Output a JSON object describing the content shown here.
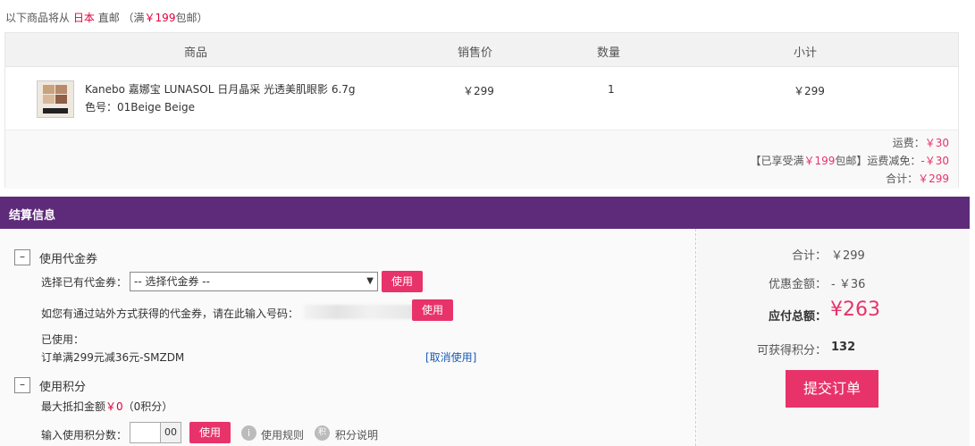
{
  "ship_note": {
    "prefix": "以下商品将从",
    "country": "日本",
    "suffix": "直邮",
    "free_prefix": "（满",
    "free_amount": "￥199",
    "free_suffix": "包邮）"
  },
  "table": {
    "headers": {
      "product": "商品",
      "price": "销售价",
      "qty": "数量",
      "subtotal": "小计"
    },
    "item": {
      "name": "Kanebo 嘉娜宝 LUNASOL 日月晶采 光透美肌眼影 6.7g",
      "color": "色号：01Beige Beige",
      "price": "￥299",
      "qty": "1",
      "subtotal": "￥299"
    },
    "fees": {
      "shipping_label": "运费：",
      "shipping_value": "￥30",
      "discount_prefix": "【已享受满",
      "discount_amount": "￥199",
      "discount_mid": "包邮】运费减免：",
      "discount_value": "-￥30",
      "total_label": "合计：",
      "total_value": "￥299"
    }
  },
  "section_title": "结算信息",
  "coupon": {
    "toggle": "–",
    "title": "使用代金券",
    "select_label": "选择已有代金券：",
    "select_value": "-- 选择代金券 --",
    "use_button": "使用",
    "code_prompt": "如您有通过站外方式获得的代金券，请在此输入号码：",
    "code_button": "使用",
    "used_label": "已使用：",
    "used_coupon": "订单满299元减36元-SMZDM",
    "cancel_link": "[取消使用]"
  },
  "points": {
    "toggle": "–",
    "title": "使用积分",
    "max_label": "最大抵扣金额",
    "max_amount": "￥0",
    "max_points": "（0积分）",
    "input_label": "输入使用积分数：",
    "input_suffix": "00",
    "use_button": "使用",
    "rules_icon": "i",
    "rules_link": "使用规则",
    "info_icon": "积",
    "info_link": "积分说明"
  },
  "summary": {
    "total_label": "合计：",
    "total_value": "￥299",
    "discount_label": "优惠金额：",
    "discount_value": "- ￥36",
    "payable_label": "应付总额：",
    "payable_value": "¥263",
    "points_label": "可获得积分：",
    "points_value": "132",
    "submit": "提交订单"
  },
  "colors": {
    "accent": "#e8336a",
    "header_bar": "#5e2b7a",
    "link": "#1a5bb5",
    "alert": "#e2003b"
  }
}
